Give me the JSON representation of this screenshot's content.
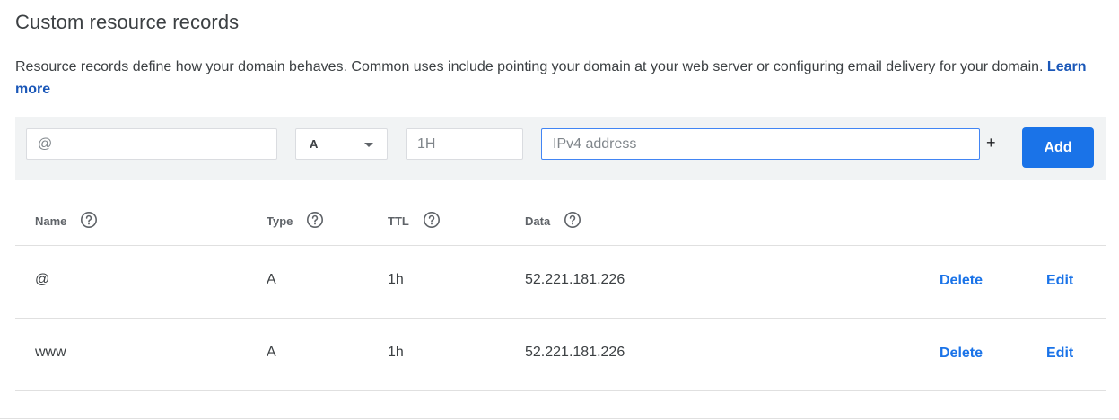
{
  "section": {
    "title": "Custom resource records",
    "description": "Resource records define how your domain behaves. Common uses include pointing your domain at your web server or configuring email delivery for your domain.",
    "learn_more": "Learn more"
  },
  "add_form": {
    "name_placeholder": "@",
    "type_value": "A",
    "ttl_placeholder": "1H",
    "data_placeholder": "IPv4 address",
    "plus_label": "+",
    "add_label": "Add"
  },
  "table": {
    "headers": {
      "name": "Name",
      "type": "Type",
      "ttl": "TTL",
      "data": "Data"
    },
    "rows": [
      {
        "name": "@",
        "type": "A",
        "ttl": "1h",
        "data": "52.221.181.226",
        "delete": "Delete",
        "edit": "Edit"
      },
      {
        "name": "www",
        "type": "A",
        "ttl": "1h",
        "data": "52.221.181.226",
        "delete": "Delete",
        "edit": "Edit"
      }
    ]
  },
  "colors": {
    "accent": "#1a73e8",
    "link": "#1a57b8",
    "bar_bg": "#f1f3f4",
    "divider": "#e0e0e0"
  },
  "icons": {
    "help": "help-circle-icon",
    "dropdown": "chevron-down-icon"
  }
}
